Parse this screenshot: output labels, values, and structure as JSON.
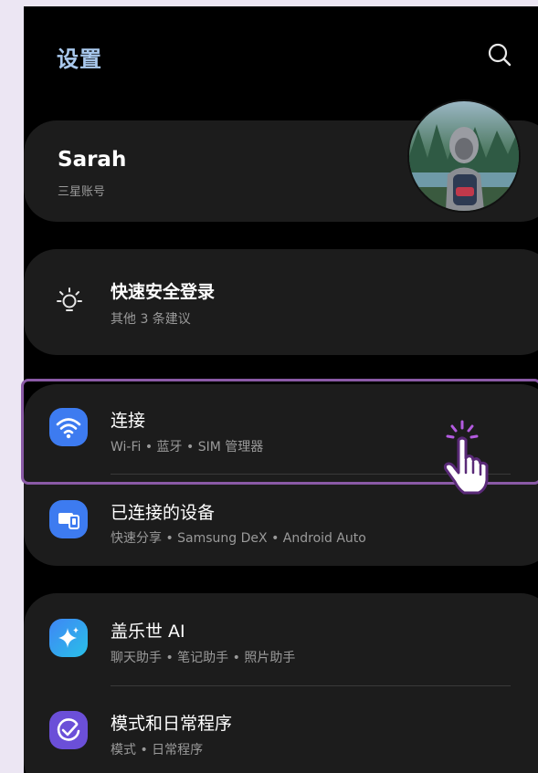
{
  "header": {
    "title": "设置",
    "search_icon": "search-icon"
  },
  "profile": {
    "name": "Sarah",
    "subtitle": "三星账号",
    "avatar": "avatar-photo"
  },
  "quick_login": {
    "title": "快速安全登录",
    "subtitle": "其他 3 条建议",
    "icon": "lightbulb-icon"
  },
  "connections": {
    "title": "连接",
    "subtitle": "Wi-Fi • 蓝牙 • SIM 管理器",
    "icon": "wifi-icon",
    "icon_color": "#3d7bf0"
  },
  "devices": {
    "title": "已连接的设备",
    "subtitle": "快速分享 • Samsung DeX • Android Auto",
    "icon": "connected-devices-icon",
    "icon_color": "#3d7bf0"
  },
  "galaxy_ai": {
    "title": "盖乐世 AI",
    "subtitle": "聊天助手 • 笔记助手 • 照片助手",
    "icon": "sparkle-icon",
    "icon_color": "#3f86f5"
  },
  "modes": {
    "title": "模式和日常程序",
    "subtitle": "模式 • 日常程序",
    "icon": "modes-check-icon",
    "icon_color": "#6b4fd8"
  },
  "overlay": {
    "highlight_color": "#8a5aa6",
    "pointer_icon": "tap-hand-icon"
  }
}
